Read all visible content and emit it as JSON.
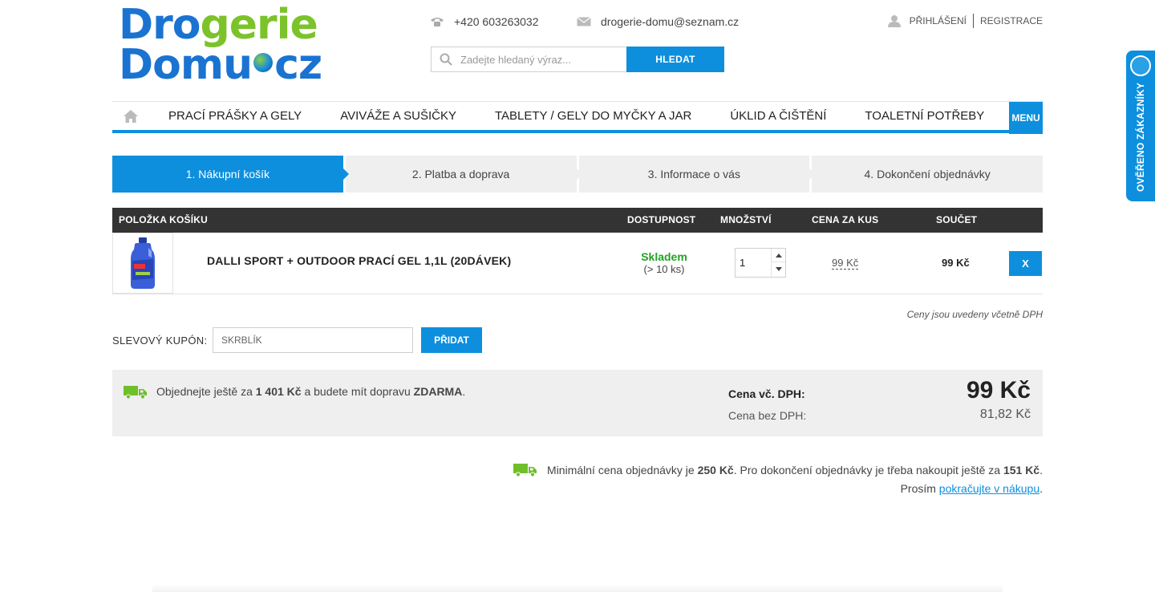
{
  "logo": {
    "line1_a": "Dro",
    "line1_b": "gerie",
    "line2_a": "Domu",
    "line2_b": "cz"
  },
  "header": {
    "phone": "+420 603263032",
    "email": "drogerie-domu@seznam.cz",
    "search_placeholder": "Zadejte hledaný výraz...",
    "search_button": "HLEDAT",
    "login": "PŘIHLÁŠENÍ",
    "register": "REGISTRACE"
  },
  "nav": {
    "items": [
      "PRACÍ PRÁŠKY A GELY",
      "AVIVÁŽE A SUŠIČKY",
      "TABLETY / GELY DO MYČKY A JAR",
      "ÚKLID A ČIŠTĚNÍ",
      "TOALETNÍ POTŘEBY"
    ],
    "menu": "MENU"
  },
  "badge": {
    "text": "OVĚŘENO ZÁKAZNÍKY"
  },
  "steps": [
    "1. Nákupní košík",
    "2. Platba a doprava",
    "3. Informace o vás",
    "4. Dokončení objednávky"
  ],
  "cart": {
    "headers": {
      "item": "POLOŽKA KOŠÍKU",
      "availability": "DOSTUPNOST",
      "quantity": "MNOŽSTVÍ",
      "unit_price": "CENA ZA KUS",
      "total": "SOUČET"
    },
    "rows": [
      {
        "name": "DALLI SPORT + OUTDOOR PRACÍ GEL 1,1L (20DÁVEK)",
        "status": "Skladem",
        "stock": "(> 10 ks)",
        "quantity": "1",
        "unit_price": "99 Kč",
        "total": "99 Kč",
        "remove": "X"
      }
    ],
    "vat_note": "Ceny jsou uvedeny včetně DPH"
  },
  "coupon": {
    "label": "SLEVOVÝ KUPÓN:",
    "value": "SKRBLÍK",
    "button": "PŘIDAT"
  },
  "summary": {
    "ship_pre": "Objednejte ještě za ",
    "ship_amount": "1 401 Kč",
    "ship_mid": " a budete mít dopravu ",
    "ship_free": "ZDARMA",
    "ship_end": ".",
    "price_vat_label": "Cena vč. DPH:",
    "price_vat": "99 Kč",
    "price_novat_label": "Cena bez DPH:",
    "price_novat": "81,82 Kč"
  },
  "minimum": {
    "pre": "Minimální cena objednávky je ",
    "min": "250 Kč",
    "mid": ". Pro dokončení objednávky je třeba nakoupit ještě za ",
    "remaining": "151 Kč",
    "end": ".",
    "please": "Prosím ",
    "link": "pokračujte v nákupu",
    "dot": "."
  },
  "colors": {
    "accent": "#0d8fde",
    "dark_header": "#333333",
    "in_stock": "#23a226",
    "truck": "#6fbf2a",
    "panel": "#efefef"
  }
}
